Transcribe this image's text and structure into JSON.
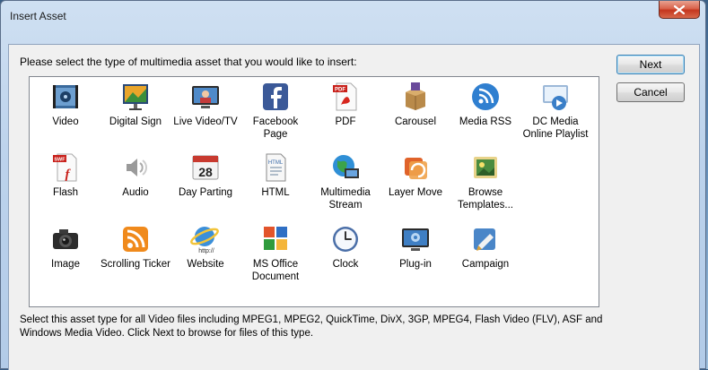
{
  "window": {
    "title": "Insert Asset"
  },
  "prompt": "Please select the type of multimedia asset that you would like to insert:",
  "assets": [
    {
      "label": "Video",
      "icon": "video-film-icon"
    },
    {
      "label": "Digital Sign",
      "icon": "digital-sign-icon"
    },
    {
      "label": "Live Video/TV",
      "icon": "tv-icon"
    },
    {
      "label": "Facebook Page",
      "icon": "facebook-icon"
    },
    {
      "label": "PDF",
      "icon": "pdf-icon"
    },
    {
      "label": "Carousel",
      "icon": "carousel-box-icon"
    },
    {
      "label": "Media RSS",
      "icon": "rss-icon"
    },
    {
      "label": "DC Media Online Playlist",
      "icon": "playlist-icon"
    },
    {
      "label": "Flash",
      "icon": "flash-icon"
    },
    {
      "label": "Audio",
      "icon": "speaker-icon"
    },
    {
      "label": "Day Parting",
      "icon": "calendar-icon"
    },
    {
      "label": "HTML",
      "icon": "html-doc-icon"
    },
    {
      "label": "Multimedia Stream",
      "icon": "globe-stream-icon"
    },
    {
      "label": "Layer Move",
      "icon": "layer-move-icon"
    },
    {
      "label": "Browse Templates...",
      "icon": "templates-icon"
    },
    {
      "label": "Image",
      "icon": "camera-icon"
    },
    {
      "label": "Scrolling Ticker",
      "icon": "ticker-icon"
    },
    {
      "label": "Website",
      "icon": "ie-globe-icon"
    },
    {
      "label": "MS Office Document",
      "icon": "office-icon"
    },
    {
      "label": "Clock",
      "icon": "clock-icon"
    },
    {
      "label": "Plug-in",
      "icon": "plugin-icon"
    },
    {
      "label": "Campaign",
      "icon": "campaign-icon"
    }
  ],
  "buttons": {
    "next": "Next",
    "cancel": "Cancel"
  },
  "description": "Select this asset type for all Video files including MPEG1, MPEG2, QuickTime, DivX, 3GP, MPEG4, Flash Video (FLV), ASF and Windows Media Video. Click Next to browse for files of this type.",
  "colors": {
    "title_gradient_top": "#cfe0f2",
    "close_red": "#c4361e",
    "list_bg": "#ffffff",
    "default_button_border": "#3c7fb1"
  }
}
